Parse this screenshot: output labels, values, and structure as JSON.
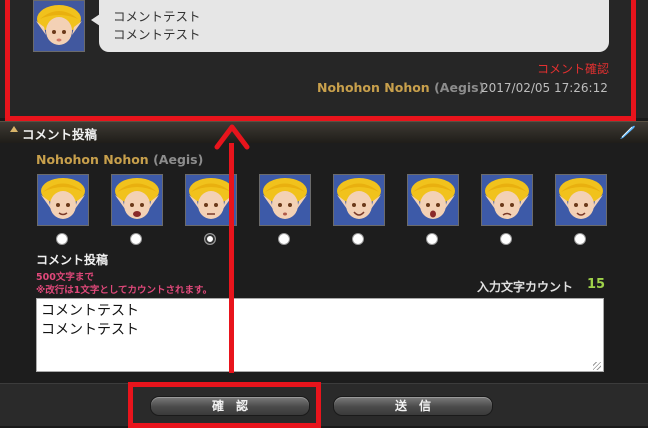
{
  "comment": {
    "text": "コメントテスト\nコメントテスト",
    "confirm_link": "コメント確認",
    "author": "Nohohon Nohon",
    "world": "(Aegis)",
    "timestamp": "2017/02/05 17:26:12"
  },
  "compose": {
    "header_title": "コメント投稿",
    "author": "Nohohon Nohon",
    "world": "(Aegis)",
    "expression_count": 8,
    "selected_expression": 3,
    "label": "コメント投稿",
    "hint_limit": "500文字まで",
    "hint_newline": "※改行は1文字としてカウントされます。",
    "count_label": "入力文字カウント",
    "count_value": "15",
    "textarea_value": "コメントテスト\nコメントテスト"
  },
  "buttons": {
    "confirm": "確認",
    "send": "送信"
  },
  "colors": {
    "annotation_red": "#e8141c",
    "name_gold": "#c8a04c",
    "count_green": "#9fd24a",
    "hint_pink": "#e0487a"
  },
  "icons": {
    "header": "triangle-up-icon",
    "edit": "feather-quill-icon",
    "avatar": "lalafell-portrait-icon"
  }
}
